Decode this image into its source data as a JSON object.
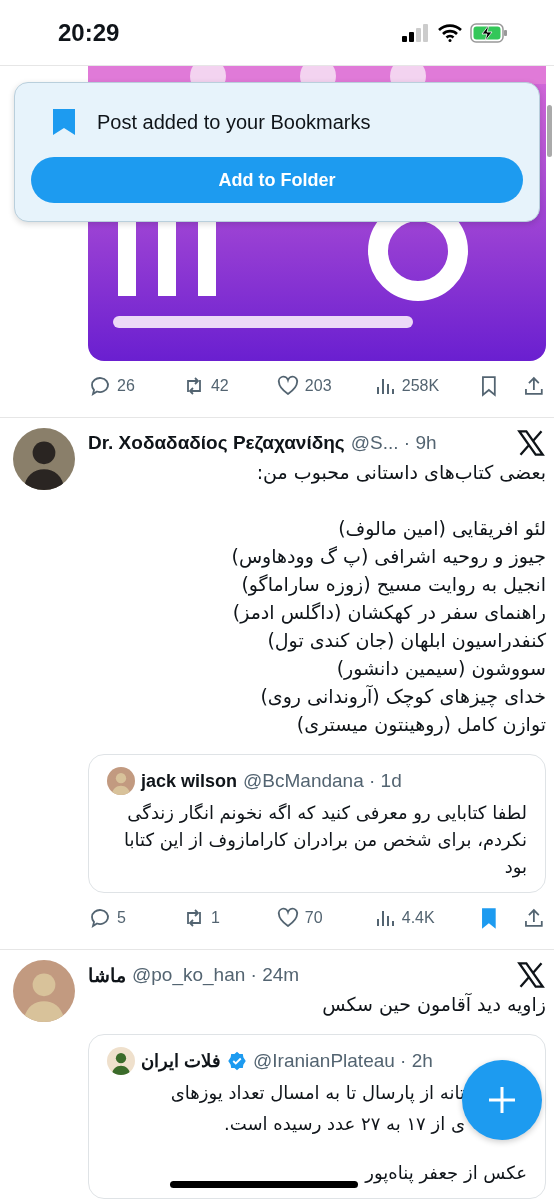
{
  "status_bar": {
    "time": "20:29"
  },
  "toast": {
    "message": "Post added to your Bookmarks",
    "button": "Add to Folder"
  },
  "posts": [
    {
      "kind": "media",
      "stats": {
        "replies": "26",
        "reposts": "42",
        "likes": "203",
        "views": "258K",
        "bookmarked": false
      }
    },
    {
      "kind": "text",
      "name": "Dr. Χοδαδαδίος Ρεζαχανίδης",
      "meta": "@S... · 9h",
      "text": "بعضی کتاب‌های داستانی محبوب من:\n\nلئو افریقایی (امین مالوف)\nجیوز و روحیه اشرافی (پ گ وودهاوس)\nانجیل به روایت مسیح (زوزه ساراماگو)\nراهنمای سفر در کهکشان (داگلس ادمز)\nکنفدراسیون ابلهان (جان کندی تول)\nسووشون (سیمین دانشور)\nخدای چیزهای کوچک (آروندانی روی)\nتوازن کامل (روهینتون میستری)",
      "quote": {
        "name": "jack wilson",
        "verified": false,
        "meta": "@BcMandana · 1d",
        "lines": [
          {
            "text": "لطفا کتابایی رو معرفی کنید که اگه نخونم انگار زندگی نکردم، برای شخص من برادران کارامازوف از این کتابا بود"
          }
        ]
      },
      "stats": {
        "replies": "5",
        "reposts": "1",
        "likes": "70",
        "views": "4.4K",
        "bookmarked": true
      }
    },
    {
      "kind": "text",
      "name": "ماشا",
      "meta": "@po_ko_han · 24m",
      "text": "زاویه دید آقامون حین سکس",
      "quote": {
        "name": "فلات ایران",
        "verified": true,
        "meta": "@IranianPlateau · 2h",
        "lines": [
          {
            "text": "تانه از پارسال تا به امسال تعداد یوزهای"
          },
          {
            "text": "ی از ۱۷ به ۲۷ عدد رسیده است."
          },
          {
            "text": "عکس از جعفر پناه‌پور",
            "gap_before": true
          }
        ]
      }
    }
  ]
}
